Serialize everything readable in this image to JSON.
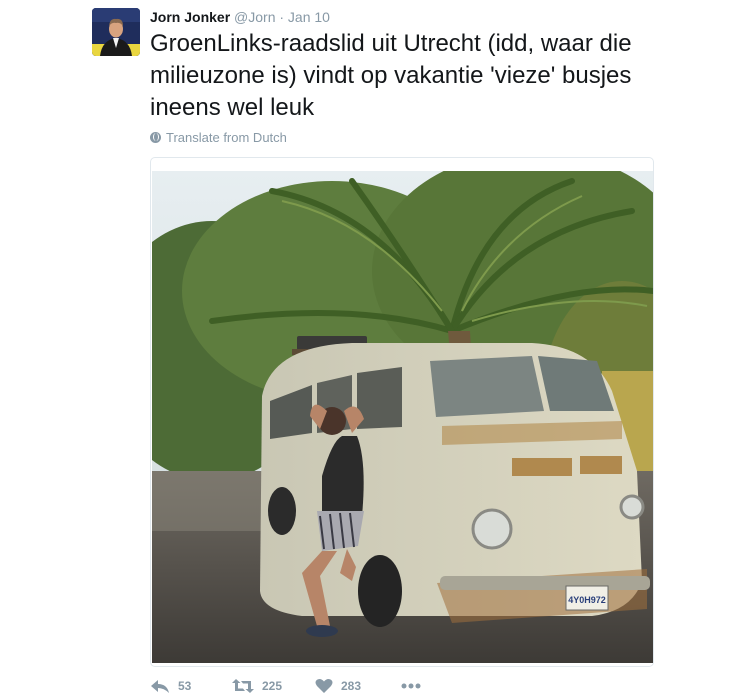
{
  "tweet": {
    "author_name": "Jorn Jonker",
    "handle_time": "@Jorn · Jan 10",
    "text": "GroenLinks-raadslid uit Utrecht (idd, waar die milieuzone is) vindt op vakantie 'vieze' busjes ineens wel leuk",
    "translate_label": "Translate from Dutch",
    "photo": {
      "license_plate": "4Y0H972"
    },
    "actions": {
      "reply_count": "53",
      "retweet_count": "225",
      "like_count": "283"
    }
  },
  "colors": {
    "text": "#14171a",
    "muted": "#8899a6",
    "border": "#e1e8ed"
  },
  "icons": [
    "globe-icon",
    "reply-icon",
    "retweet-icon",
    "heart-icon",
    "more-icon"
  ]
}
